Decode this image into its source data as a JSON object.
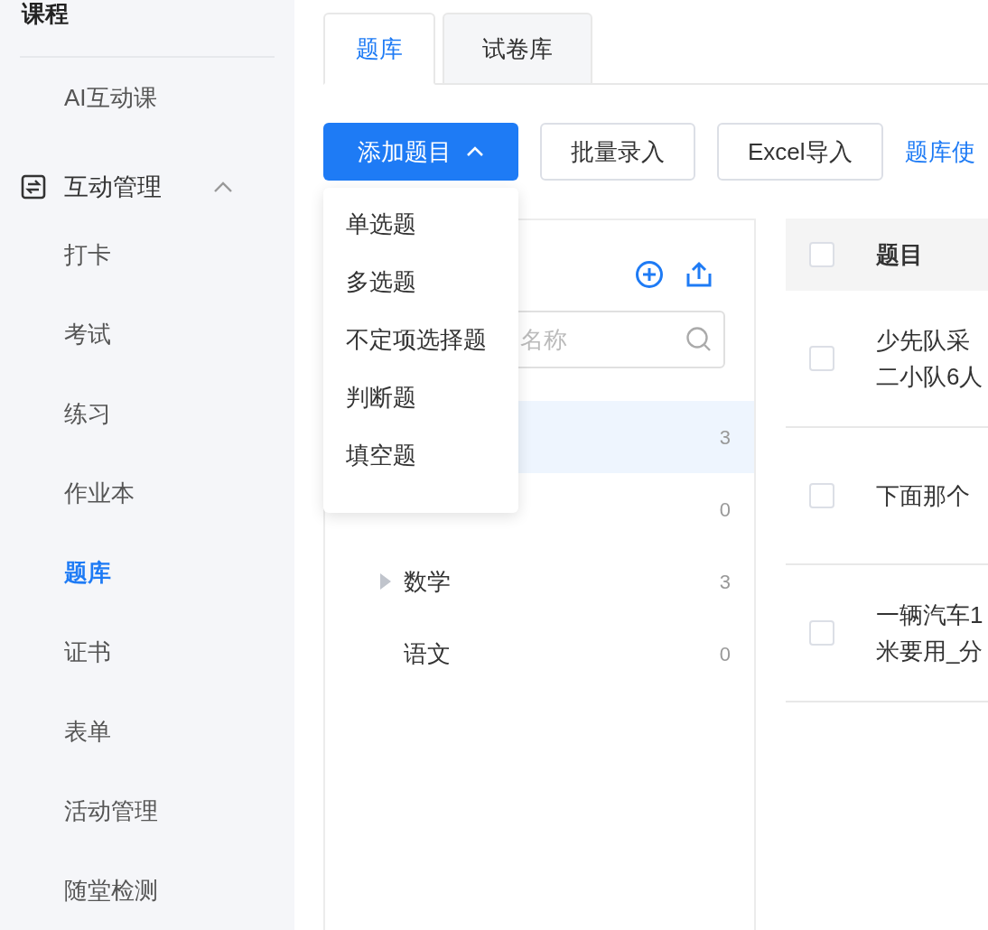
{
  "sidebar": {
    "title": "课程",
    "items": [
      {
        "label": "AI互动课",
        "kind": "item",
        "selected": false
      },
      {
        "label": "互动管理",
        "kind": "group",
        "expanded": true
      },
      {
        "label": "打卡",
        "kind": "item",
        "selected": false
      },
      {
        "label": "考试",
        "kind": "item",
        "selected": false
      },
      {
        "label": "练习",
        "kind": "item",
        "selected": false
      },
      {
        "label": "作业本",
        "kind": "item",
        "selected": false
      },
      {
        "label": "题库",
        "kind": "item",
        "selected": true
      },
      {
        "label": "证书",
        "kind": "item",
        "selected": false
      },
      {
        "label": "表单",
        "kind": "item",
        "selected": false
      },
      {
        "label": "活动管理",
        "kind": "item",
        "selected": false
      },
      {
        "label": "随堂检测",
        "kind": "item",
        "selected": false
      }
    ]
  },
  "tabs": [
    {
      "label": "题库",
      "selected": true
    },
    {
      "label": "试卷库",
      "selected": false
    }
  ],
  "toolbar": {
    "add_button": "添加题目",
    "buttons": [
      "批量录入",
      "Excel导入"
    ],
    "link": "题库使"
  },
  "add_menu": {
    "items": [
      "单选题",
      "多选题",
      "不定项选择题",
      "判断题",
      "填空题"
    ]
  },
  "category_tree": {
    "search": {
      "placeholder": "名称"
    },
    "rows": [
      {
        "count": "3",
        "selected": true
      },
      {
        "count": "0",
        "selected": false
      },
      {
        "label": "数学",
        "count": "3",
        "selected": false,
        "has_children": true
      },
      {
        "label": "语文",
        "count": "0",
        "selected": false
      }
    ]
  },
  "table": {
    "header": "题目",
    "header_checked": false,
    "rows": [
      {
        "lines": [
          "少先队采",
          "二小队6人"
        ],
        "checked": false
      },
      {
        "lines": [
          "下面那个"
        ],
        "checked": false
      },
      {
        "lines": [
          "一辆汽车1",
          "米要用_分"
        ],
        "checked": false
      }
    ]
  }
}
